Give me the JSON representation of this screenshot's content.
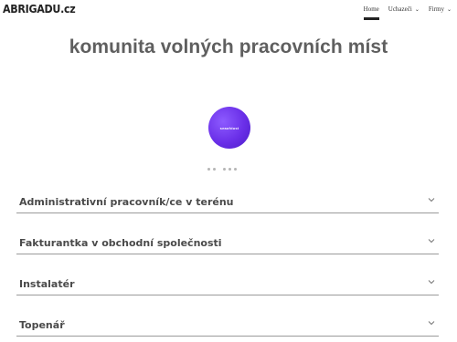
{
  "header": {
    "logo": "ABRIGADU.cz",
    "nav": [
      {
        "label": "Home",
        "active": true,
        "dropdown": false
      },
      {
        "label": "Uchazeči",
        "active": false,
        "dropdown": true
      },
      {
        "label": "Firmy",
        "active": false,
        "dropdown": true
      }
    ]
  },
  "main": {
    "title": "komunita volných pracovních míst",
    "carousel": {
      "logo_text": "seaofdust"
    },
    "jobs": [
      {
        "label": "Administrativní pracovník/ce v terénu"
      },
      {
        "label": "Fakturantka v obchodní společnosti"
      },
      {
        "label": "Instalatér"
      },
      {
        "label": "Topenář"
      }
    ]
  },
  "colors": {
    "accent": "#6a2fe8",
    "title": "#5f5f5f",
    "divider": "#9a9a9a"
  },
  "icons": {
    "dropdown": "chevron-down-icon"
  }
}
